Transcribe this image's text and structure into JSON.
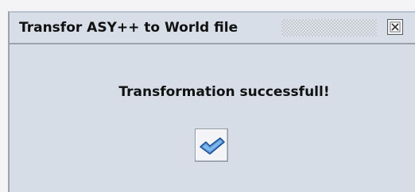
{
  "window": {
    "title": "Transfor ASY++ to World file"
  },
  "dialog": {
    "message": "Transformation successfull!",
    "ok_icon": "checkmark-icon"
  },
  "colors": {
    "window_bg": "#d6dde6",
    "check_fill": "#4f93d8",
    "check_outline": "#1f4f8f"
  }
}
